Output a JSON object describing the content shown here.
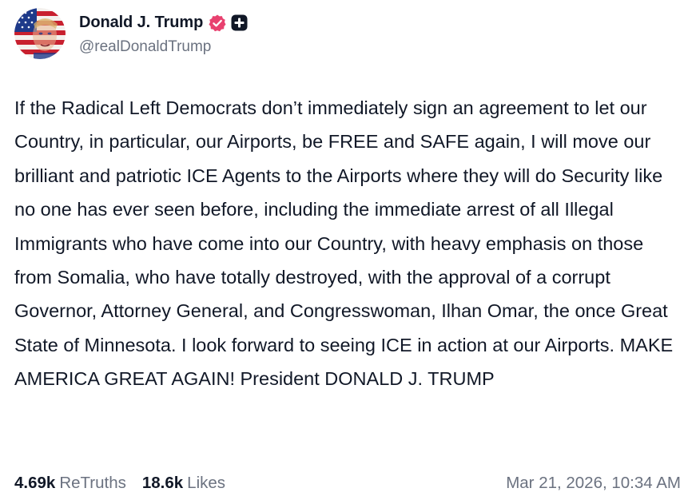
{
  "author": {
    "display_name": "Donald J. Trump",
    "handle": "@realDonaldTrump",
    "avatar_icon": "flag-portrait-avatar",
    "verified_icon": "verified-badge-icon",
    "verified_color": "#e8416f",
    "plus_icon": "plus-badge-icon"
  },
  "post": {
    "text": "If the Radical Left Democrats don’t immediately sign an agreement to let our Country, in particular, our Airports, be FREE and SAFE again, I will move our brilliant and patriotic ICE Agents to the Airports where they will do Security like no one has ever seen before, including the immediate arrest of all Illegal Immigrants who have come into our Country, with heavy emphasis on those from Somalia, who have totally destroyed, with the approval of a corrupt Governor, Attorney General, and Congresswoman, Ilhan Omar, the once Great State of Minnesota. I look forward to seeing ICE in action at our Airports. MAKE AMERICA GREAT AGAIN! President DONALD J. TRUMP"
  },
  "stats": {
    "retruths_count": "4.69k",
    "retruths_label": "ReTruths",
    "likes_count": "18.6k",
    "likes_label": "Likes"
  },
  "timestamp": "Mar 21, 2026, 10:34 AM",
  "colors": {
    "text_primary": "#111827",
    "text_secondary": "#6b7280",
    "background": "#ffffff"
  }
}
